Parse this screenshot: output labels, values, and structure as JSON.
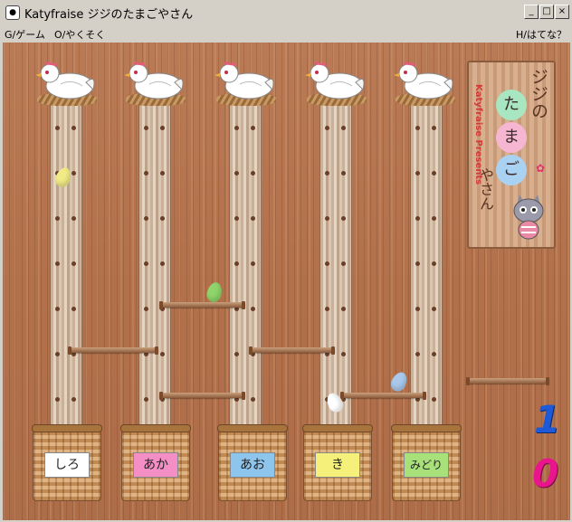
{
  "window": {
    "title": "Katyfraise ジジのたまごやさん",
    "minimize_label": "_",
    "maximize_label": "□",
    "close_label": "×"
  },
  "menu": {
    "game": "G/ゲーム",
    "promise": "O/やくそく",
    "help": "H/はてな？"
  },
  "sign": {
    "presents": "Katyfraise Presents",
    "title_top": "ジジの",
    "ball1": "た",
    "ball2": "ま",
    "ball3": "ご",
    "title_bottom": "やさん"
  },
  "baskets": [
    {
      "label": "しろ",
      "color": "#ffffff"
    },
    {
      "label": "あか",
      "color": "#f48fc6"
    },
    {
      "label": "あお",
      "color": "#8ec5ec"
    },
    {
      "label": "き",
      "color": "#f4f07a"
    },
    {
      "label": "みどり",
      "color": "#a8e07a"
    }
  ],
  "eggs": [
    {
      "color": "#f2ea86"
    },
    {
      "color": "#8ed46a"
    },
    {
      "color": "#a9c8ec"
    },
    {
      "color": "#ffffff"
    }
  ],
  "scores": {
    "top": "1",
    "bottom": "0"
  },
  "colors": {
    "score_top": "#1e5ad8",
    "score_bottom": "#e8158c"
  }
}
